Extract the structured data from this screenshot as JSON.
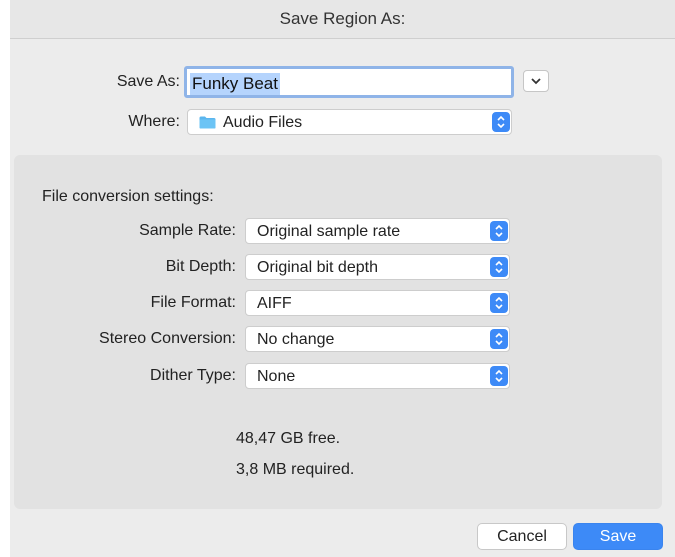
{
  "dialog": {
    "title": "Save Region As:",
    "save_as_label": "Save As:",
    "save_as_value": "Funky Beat",
    "where_label": "Where:",
    "where_value": "Audio Files",
    "where_icon": "folder-icon",
    "accent_color": "#3d8af7",
    "folder_color": "#5bb6ee"
  },
  "conversion": {
    "title": "File conversion settings:",
    "fields": [
      {
        "label": "Sample Rate:",
        "value": "Original sample rate"
      },
      {
        "label": "Bit Depth:",
        "value": "Original bit depth"
      },
      {
        "label": "File Format:",
        "value": "AIFF"
      },
      {
        "label": "Stereo Conversion:",
        "value": "No change"
      },
      {
        "label": "Dither Type:",
        "value": "None"
      }
    ]
  },
  "storage": {
    "free": "48,47 GB free.",
    "required": "3,8 MB required."
  },
  "buttons": {
    "cancel": "Cancel",
    "save": "Save"
  }
}
